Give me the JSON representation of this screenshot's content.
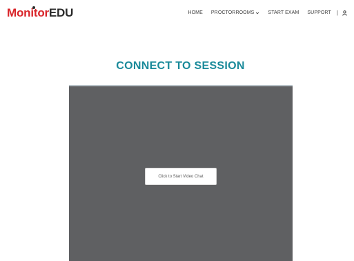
{
  "logo": {
    "part1": "Monitor",
    "part2": "EDU"
  },
  "nav": {
    "home": "HOME",
    "proctorrooms": "PROCTORROOMS",
    "start_exam": "START EXAM",
    "support": "SUPPORT",
    "separator": "|"
  },
  "icons": {
    "dropdown": "chevron-down-icon",
    "user": "user-icon"
  },
  "main": {
    "title": "CONNECT TO SESSION",
    "video_button": "Click to Start Video Chat"
  },
  "colors": {
    "brand_red": "#d9252a",
    "title_teal": "#1a8a9a",
    "video_bg": "#5f6062"
  }
}
